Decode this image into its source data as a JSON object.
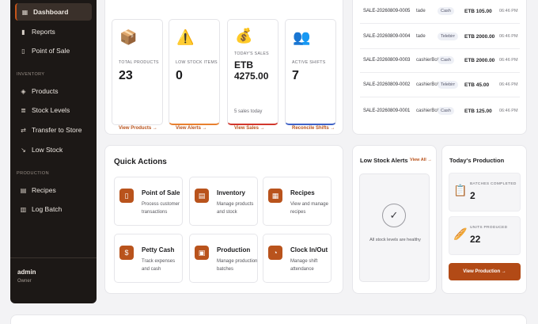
{
  "sidebar": {
    "items": [
      {
        "label": "Dashboard",
        "icon": "grid-icon"
      },
      {
        "label": "Reports",
        "icon": "bar-chart-icon"
      },
      {
        "label": "Point of Sale",
        "icon": "pos-terminal-icon"
      }
    ],
    "inventory_label": "INVENTORY",
    "inventory_items": [
      {
        "label": "Products",
        "icon": "box-icon"
      },
      {
        "label": "Stock Levels",
        "icon": "layers-icon"
      },
      {
        "label": "Transfer to Store",
        "icon": "transfer-icon"
      },
      {
        "label": "Low Stock",
        "icon": "trend-down-icon"
      }
    ],
    "production_label": "PRODUCTION",
    "production_items": [
      {
        "label": "Recipes",
        "icon": "recipe-book-icon"
      },
      {
        "label": "Log Batch",
        "icon": "clipboard-icon"
      }
    ],
    "user": {
      "name": "admin",
      "role": "Owner"
    }
  },
  "stats": [
    {
      "label": "TOTAL PRODUCTS",
      "value": "23",
      "link": "View Products →",
      "icon": "package-icon"
    },
    {
      "label": "LOW STOCK ITEMS",
      "value": "0",
      "link": "View Alerts →",
      "icon": "warning-icon"
    },
    {
      "label": "TODAY'S SALES",
      "value": "ETB 4275.00",
      "sub": "5 sales today",
      "link": "View Sales →",
      "icon": "money-bag-icon"
    },
    {
      "label": "ACTIVE SHIFTS",
      "value": "7",
      "link": "Reconcile Shifts →",
      "icon": "people-icon"
    }
  ],
  "sales": [
    {
      "id": "SALE-20260809-0005",
      "user": "tade",
      "method": "Cash",
      "amount": "ETB 105.00",
      "time": "06:46 PM"
    },
    {
      "id": "SALE-20260809-0004",
      "user": "tade",
      "method": "Telebirr",
      "amount": "ETB 2000.00",
      "time": "06:46 PM"
    },
    {
      "id": "SALE-20260809-0003",
      "user": "cashierBole",
      "method": "Cash",
      "amount": "ETB 2000.00",
      "time": "06:46 PM"
    },
    {
      "id": "SALE-20260809-0002",
      "user": "cashierBole",
      "method": "Telebirr",
      "amount": "ETB 45.00",
      "time": "06:46 PM"
    },
    {
      "id": "SALE-20260809-0001",
      "user": "cashierBole",
      "method": "Cash",
      "amount": "ETB 125.00",
      "time": "06:46 PM"
    }
  ],
  "quick_actions": {
    "title": "Quick Actions",
    "items": [
      {
        "name": "Point of Sale",
        "desc": "Process customer transactions",
        "icon": "pos-icon"
      },
      {
        "name": "Inventory",
        "desc": "Manage products and stock",
        "icon": "inventory-icon"
      },
      {
        "name": "Recipes",
        "desc": "View and manage recipes",
        "icon": "recipe-icon"
      },
      {
        "name": "Petty Cash",
        "desc": "Track expenses and cash",
        "icon": "dollar-icon"
      },
      {
        "name": "Production",
        "desc": "Manage production batches",
        "icon": "calendar-icon"
      },
      {
        "name": "Clock In/Out",
        "desc": "Manage shift attendance",
        "icon": "clock-icon"
      }
    ]
  },
  "low_stock": {
    "title": "Low Stock Alerts",
    "link": "View All →",
    "message": "All stock levels are healthy"
  },
  "production": {
    "title": "Today's Production",
    "batches_label": "BATCHES COMPLETED",
    "batches_value": "2",
    "units_label": "UNITS PRODUCED",
    "units_value": "22",
    "button": "View Production →"
  }
}
